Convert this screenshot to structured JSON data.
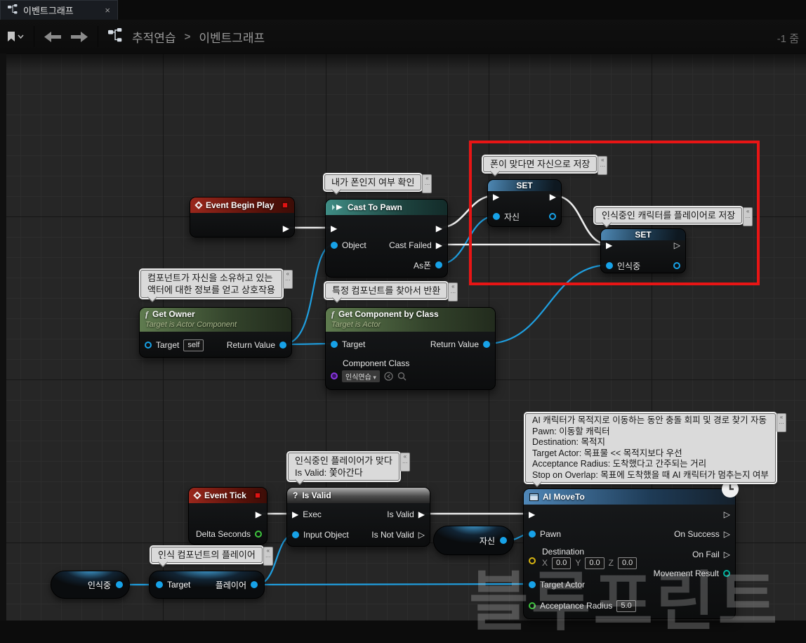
{
  "tab": {
    "title": "이벤트그래프",
    "close": "×"
  },
  "toolbar": {
    "breadcrumb_root": "추적연습",
    "sep": ">",
    "breadcrumb_current": "이벤트그래프",
    "zoom": "-1 줌"
  },
  "comments": {
    "cast": "내가 폰인지 여부 확인",
    "set_self": "폰이 맞다면 자신으로 저장",
    "set_player": "인식중인 캐릭터를 플레이어로 저장",
    "get_owner": [
      "컴포넌트가 자신을 소유하고 있는",
      "액터에 대한 정보를 얻고 상호작용"
    ],
    "get_component": "특정 컴포넌트를 찾아서 반환",
    "is_valid": [
      "인식중인 플레이어가 맞다",
      "Is Valid: 쫓아간다"
    ],
    "target_var": "인식 컴포넌트의 플레이어",
    "ai_move": [
      "AI 캐릭터가 목적지로 이동하는 동안 충돌 회피 및 경로 찾기 자동",
      "Pawn: 이동할 캐릭터",
      "Destination: 목적지",
      "Target Actor: 목표물 << 목적지보다 우선",
      "Acceptance Radius: 도착했다고 간주되는 거리",
      "Stop on Overlap: 목표에 도착했을 때 AI 캐릭터가 멈추는지 여부"
    ]
  },
  "nodes": {
    "event_begin_play": {
      "title": "Event Begin Play"
    },
    "cast_to_pawn": {
      "title": "Cast To Pawn",
      "pin_object": "Object",
      "pin_cast_failed": "Cast Failed",
      "pin_as_pawn": "As폰"
    },
    "set_self": {
      "title": "SET",
      "pin_in": "자신"
    },
    "set_player": {
      "title": "SET",
      "pin_in": "인식중"
    },
    "get_owner": {
      "title": "Get Owner",
      "subtitle": "Target is Actor Component",
      "pin_target": "Target",
      "target_value": "self",
      "pin_return": "Return Value",
      "ficon": "f"
    },
    "get_component": {
      "title": "Get Component by Class",
      "subtitle": "Target is Actor",
      "pin_target": "Target",
      "pin_return": "Return Value",
      "pin_class": "Component Class",
      "class_value": "인식연습",
      "ficon": "f"
    },
    "event_tick": {
      "title": "Event Tick",
      "pin_delta": "Delta Seconds"
    },
    "is_valid": {
      "title": "Is Valid",
      "qicon": "?",
      "pin_exec": "Exec",
      "pin_input": "Input Object",
      "pin_valid": "Is Valid",
      "pin_not_valid": "Is Not Valid"
    },
    "ai_move_to": {
      "title": "AI MoveTo",
      "pin_pawn": "Pawn",
      "pin_dest": "Destination",
      "x_label": "X",
      "x": "0.0",
      "y_label": "Y",
      "y": "0.0",
      "z_label": "Z",
      "z": "0.0",
      "pin_target_actor": "Target Actor",
      "pin_radius": "Acceptance Radius",
      "radius": "5.0",
      "pin_success": "On Success",
      "pin_fail": "On Fail",
      "pin_movement": "Movement Result"
    },
    "var_self": {
      "label": "자신"
    },
    "var_recognizing": {
      "label": "인식중"
    },
    "var_target": {
      "pin_target": "Target",
      "pin_player": "플레이어"
    }
  },
  "watermark": "블루프린트"
}
